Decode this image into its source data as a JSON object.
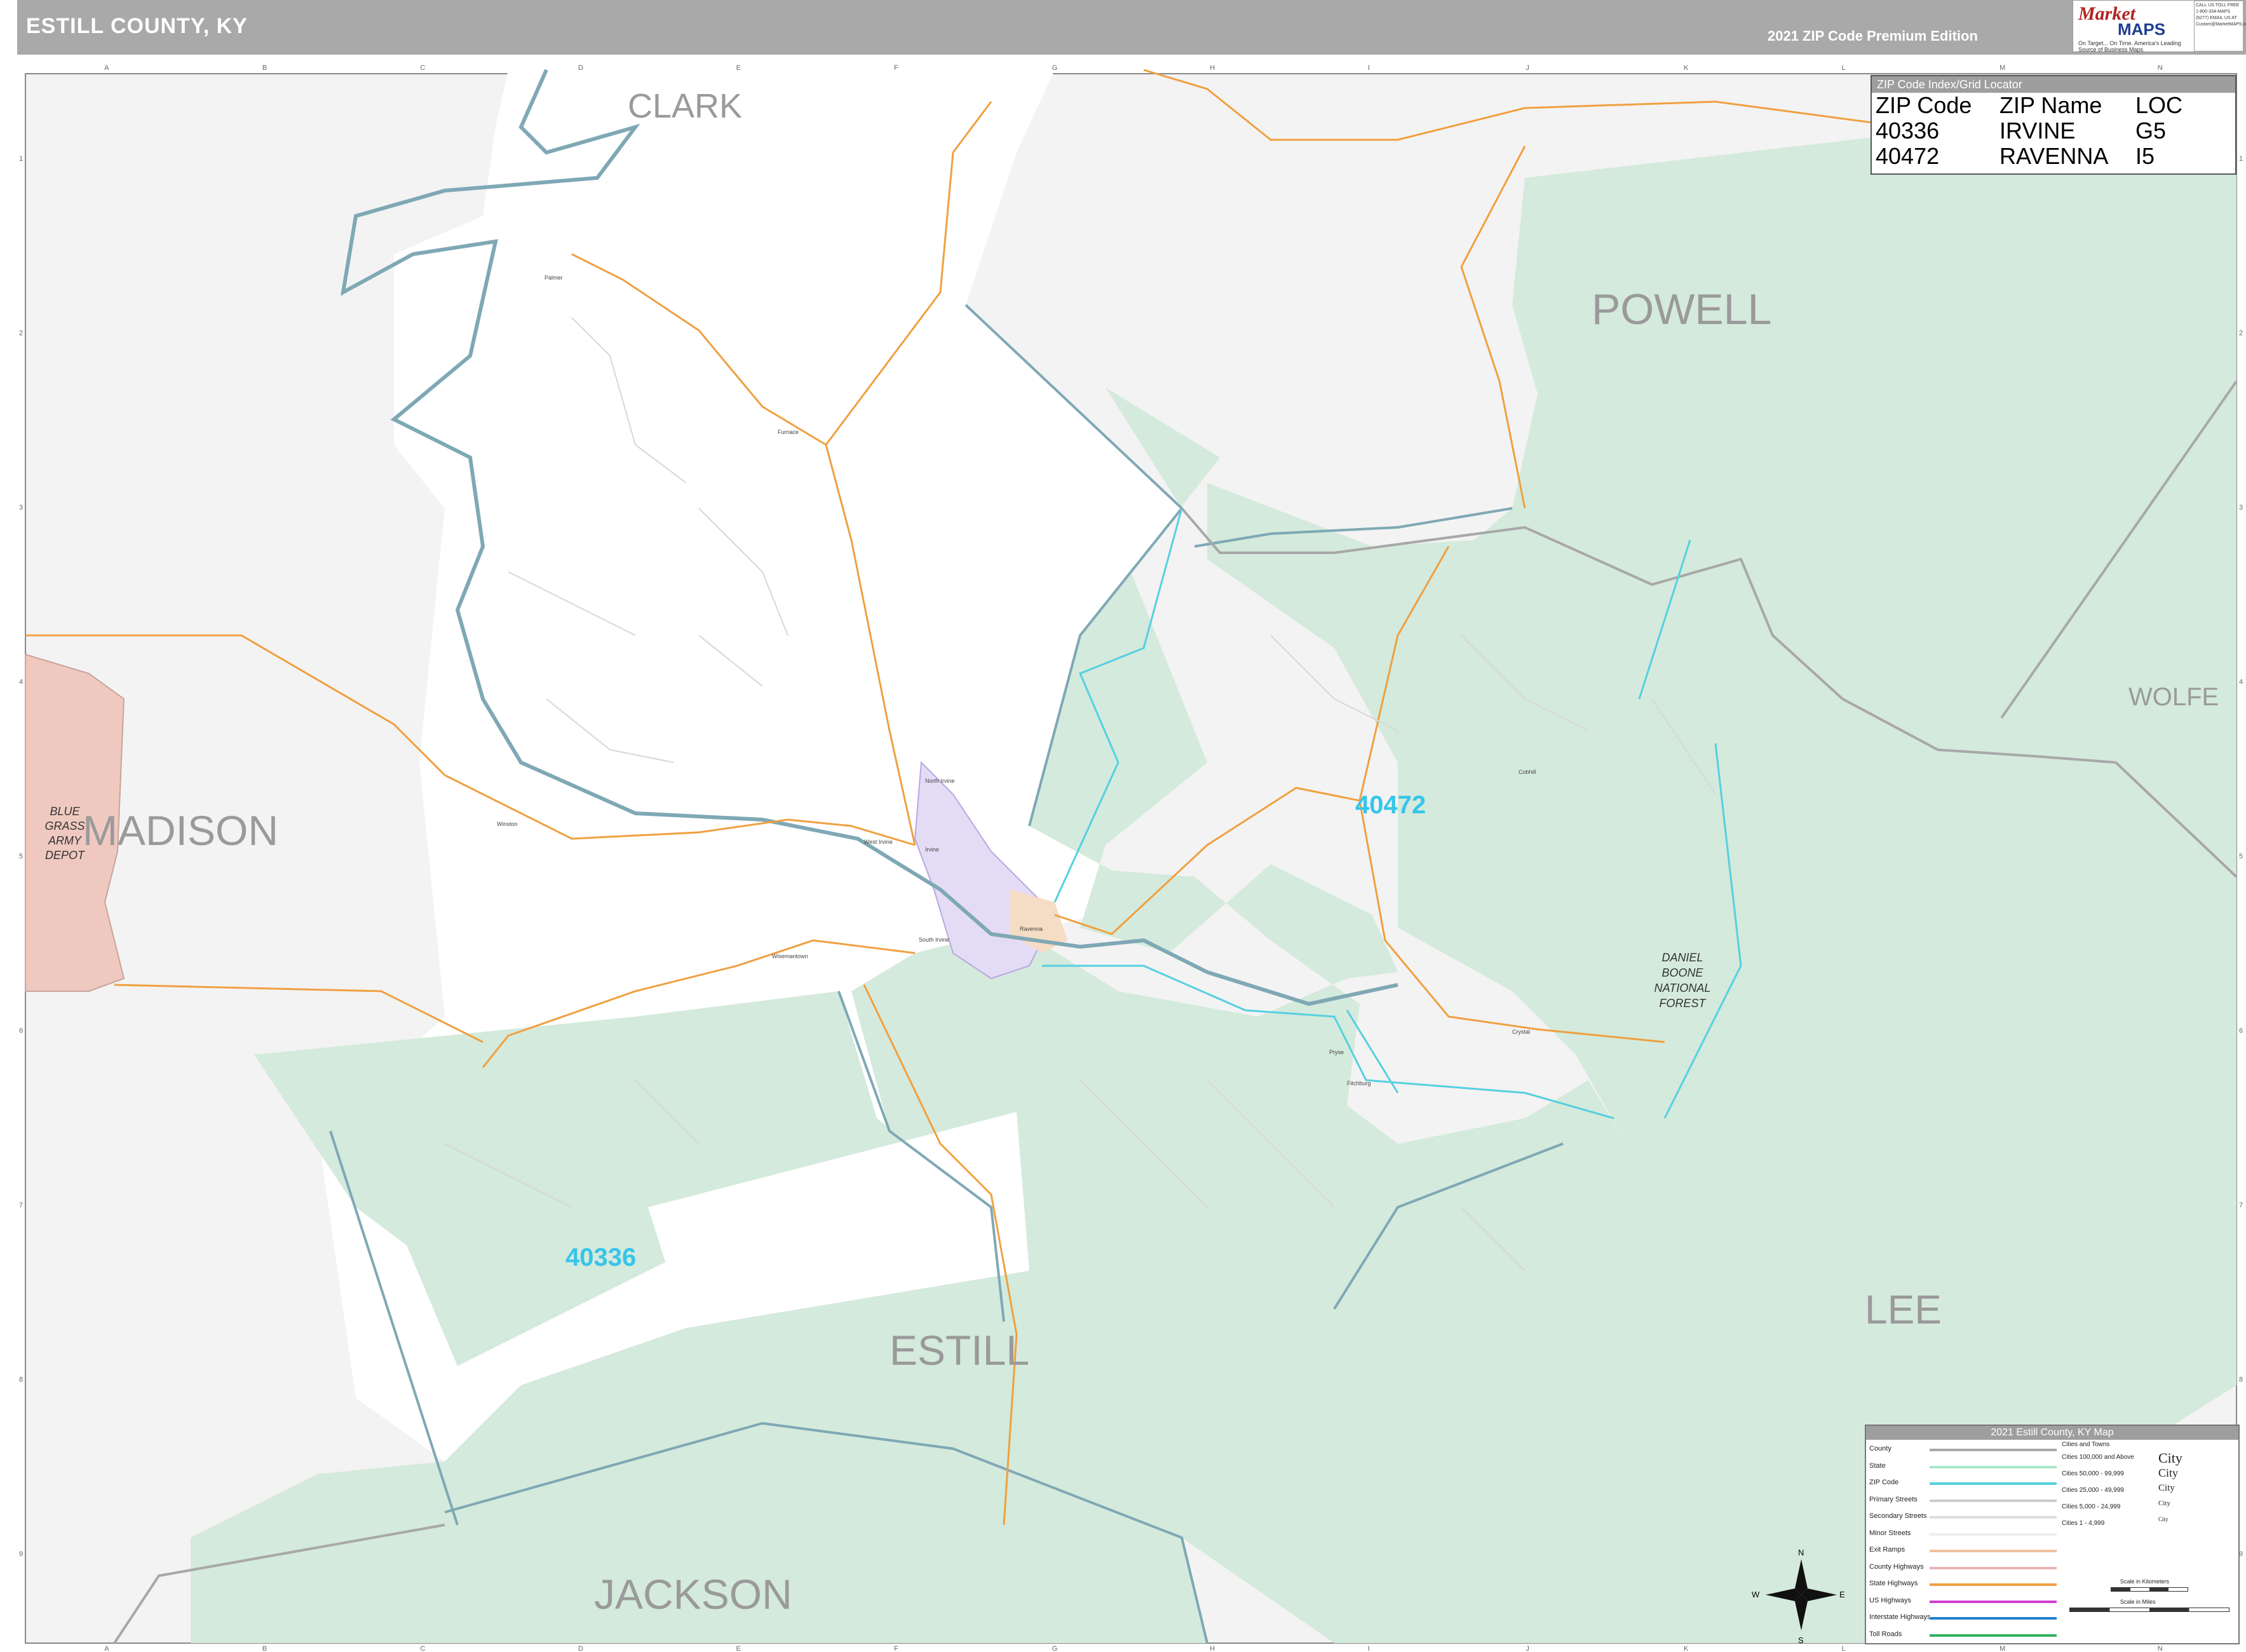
{
  "header": {
    "title": "ESTILL COUNTY, KY",
    "edition": "2021 ZIP Code Premium Edition",
    "logo_top": "Market",
    "logo_bottom": "MAPS",
    "logo_tagline": "On Target... On Time. America's Leading Source of Business Maps",
    "contact": "CALL US TOLL FREE 1-800-334-MAPS (6277) EMAIL US AT Custom@MarketMAPS.com"
  },
  "grid": {
    "columns": [
      "A",
      "B",
      "C",
      "D",
      "E",
      "F",
      "G",
      "H",
      "I",
      "J",
      "K",
      "L",
      "M",
      "N"
    ],
    "rows": [
      "1",
      "2",
      "3",
      "4",
      "5",
      "6",
      "7",
      "8",
      "9"
    ]
  },
  "counties": [
    {
      "id": "clark",
      "label": "CLARK"
    },
    {
      "id": "powell",
      "label": "POWELL"
    },
    {
      "id": "madison",
      "label": "MADISON"
    },
    {
      "id": "wolfe",
      "label": "WOLFE"
    },
    {
      "id": "lee",
      "label": "LEE"
    },
    {
      "id": "estill",
      "label": "ESTILL"
    },
    {
      "id": "jackson",
      "label": "JACKSON"
    }
  ],
  "zip_labels": [
    {
      "code": "40472"
    },
    {
      "code": "40336"
    }
  ],
  "special_areas": [
    {
      "id": "blue-grass",
      "lines": [
        "BLUE",
        "GRASS",
        "ARMY",
        "DEPOT"
      ]
    },
    {
      "id": "daniel-boone",
      "lines": [
        "DANIEL",
        "BOONE",
        "NATIONAL",
        "FOREST"
      ]
    }
  ],
  "places": [
    "Palmer",
    "Wisemantown",
    "Winston",
    "Irvine",
    "North Irvine",
    "West Irvine",
    "South Irvine",
    "Ravenna",
    "Cobhill",
    "Furnace",
    "Fitchburg",
    "Crystal",
    "Pryse"
  ],
  "zip_index": {
    "title": "ZIP Code Index/Grid Locator",
    "columns": [
      "ZIP Code",
      "ZIP Name",
      "LOC"
    ],
    "rows": [
      [
        "40336",
        "IRVINE",
        "G5"
      ],
      [
        "40472",
        "RAVENNA",
        "I5"
      ]
    ]
  },
  "legend": {
    "title": "2021 Estill County, KY Map",
    "line_items": [
      "County",
      "State",
      "ZIP Code",
      "Primary Streets",
      "Secondary Streets",
      "Minor Streets",
      "Exit Ramps",
      "County Highways",
      "State Highways",
      "US Highways",
      "Interstate Highways",
      "Toll Roads"
    ],
    "city_header": "Cities and Towns",
    "city_items": [
      {
        "label": "Cities 100,000 and Above",
        "sample": "City"
      },
      {
        "label": "Cities 50,000 - 99,999",
        "sample": "City"
      },
      {
        "label": "Cities 25,000 - 49,999",
        "sample": "City"
      },
      {
        "label": "Cities 5,000 - 24,999",
        "sample": "City"
      },
      {
        "label": "Cities 1 - 4,999",
        "sample": "City"
      }
    ],
    "scale_km": "Scale in Kilometers",
    "scale_mi": "Scale in Miles"
  },
  "compass": {
    "n": "N",
    "s": "S",
    "e": "E",
    "w": "W"
  },
  "colors": {
    "forest": "#d4eadc",
    "outside": "#f3f3f3",
    "depot": "#efc9c0",
    "zip_label": "#36c5ea",
    "county_label": "#9a9a9a",
    "county_line": "#7fa8b5",
    "state_hwy": "#f0a040"
  }
}
